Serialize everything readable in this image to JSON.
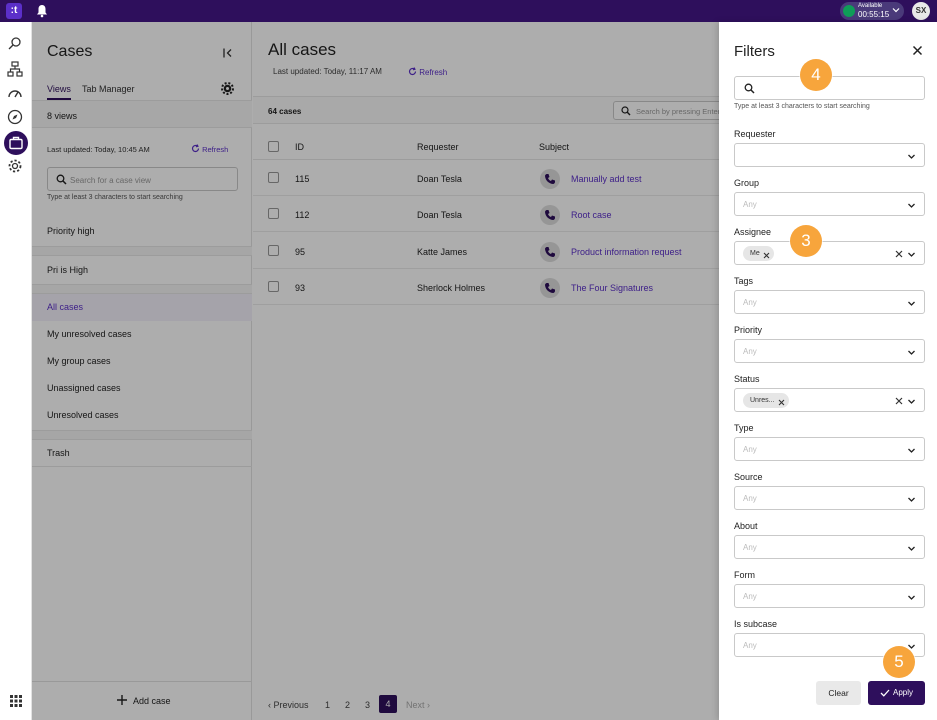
{
  "topbar": {
    "logo": ":t",
    "status_line1": "Available",
    "status_line2": "00:55:15",
    "avatar_initials": "SX"
  },
  "views_panel": {
    "title": "Cases",
    "tabs": [
      "Views",
      "Tab Manager"
    ],
    "views_count": "8 views",
    "last_updated": "Last updated: Today, 10:45 AM",
    "refresh_label": "Refresh",
    "search_placeholder": "Search for a case view",
    "search_hint": "Type at least 3 characters to start searching",
    "items": [
      {
        "label": "Priority high"
      },
      {
        "label": "Pri is High"
      },
      {
        "label": "All cases"
      },
      {
        "label": "My unresolved cases"
      },
      {
        "label": "My group cases"
      },
      {
        "label": "Unassigned cases"
      },
      {
        "label": "Unresolved cases"
      },
      {
        "label": "Trash"
      }
    ],
    "add_case_label": "Add case"
  },
  "main": {
    "title": "All cases",
    "last_updated": "Last updated:  Today, 11:17 AM",
    "refresh_label": "Refresh",
    "cases_count": "64 cases",
    "search_placeholder": "Search by pressing Enter",
    "columns": [
      "ID",
      "Requester",
      "Subject"
    ],
    "rows": [
      {
        "id": "115",
        "requester": "Doan Tesla",
        "subject": "Manually add test"
      },
      {
        "id": "112",
        "requester": "Doan Tesla",
        "subject": "Root case"
      },
      {
        "id": "95",
        "requester": "Katte James",
        "subject": "Product information request"
      },
      {
        "id": "93",
        "requester": "Sherlock Holmes",
        "subject": "The Four Signatures"
      }
    ],
    "pagination": {
      "previous": "Previous",
      "pages": [
        "1",
        "2",
        "3",
        "4"
      ],
      "current": "4",
      "next": "Next"
    }
  },
  "filters": {
    "title": "Filters",
    "search_hint": "Type at least 3 characters to start searching",
    "fields": {
      "requester": {
        "label": "Requester",
        "placeholder": ""
      },
      "group": {
        "label": "Group",
        "placeholder": "Any"
      },
      "assignee": {
        "label": "Assignee",
        "chip": "Me"
      },
      "tags": {
        "label": "Tags",
        "placeholder": "Any"
      },
      "priority": {
        "label": "Priority",
        "placeholder": "Any"
      },
      "status": {
        "label": "Status",
        "chip": "Unres..."
      },
      "type": {
        "label": "Type",
        "placeholder": "Any"
      },
      "source": {
        "label": "Source",
        "placeholder": "Any"
      },
      "about": {
        "label": "About",
        "placeholder": "Any"
      },
      "form": {
        "label": "Form",
        "placeholder": "Any"
      },
      "is_subcase": {
        "label": "Is subcase",
        "placeholder": "Any"
      }
    },
    "clear_label": "Clear",
    "apply_label": "Apply"
  },
  "step_badges": [
    "4",
    "3",
    "5"
  ],
  "colors": {
    "brand": "#2e0f5c",
    "accent": "#5b2fc9",
    "badge": "#f7a53c",
    "available": "#0f9d58"
  }
}
